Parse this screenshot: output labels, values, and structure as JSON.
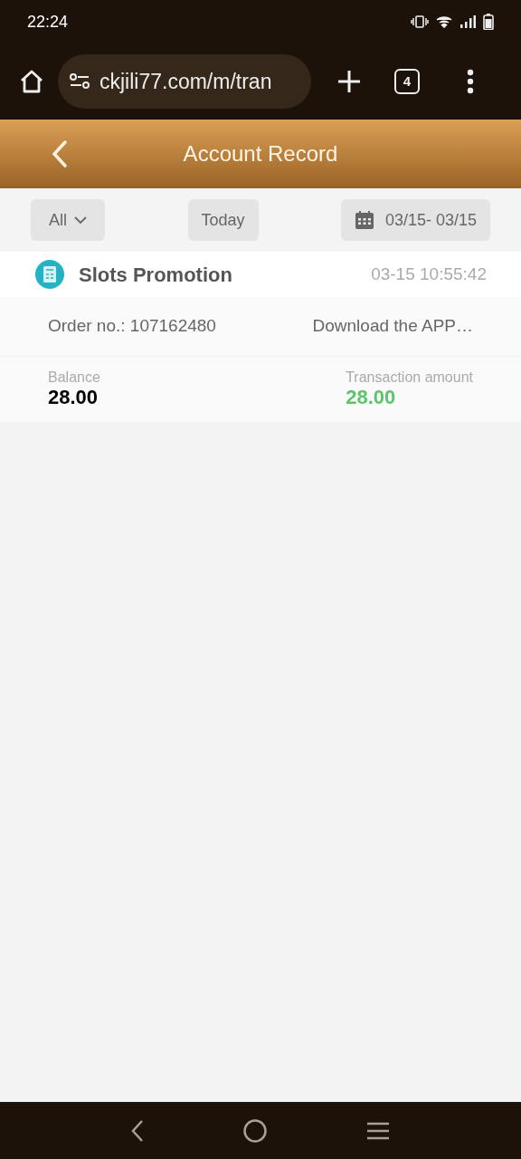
{
  "status_bar": {
    "time": "22:24"
  },
  "browser": {
    "url": "ckjili77.com/m/tran",
    "tab_count": "4"
  },
  "header": {
    "title": "Account Record"
  },
  "filters": {
    "type": "All",
    "period": "Today",
    "date_range": "03/15- 03/15"
  },
  "records": [
    {
      "title": "Slots Promotion",
      "time": "03-15 10:55:42",
      "order": "Order no.: 107162480",
      "remark": "Download the APP…",
      "balance_label": "Balance",
      "balance": "28.00",
      "amount_label": "Transaction amount",
      "amount": "28.00",
      "color": "#5cc56a"
    }
  ]
}
